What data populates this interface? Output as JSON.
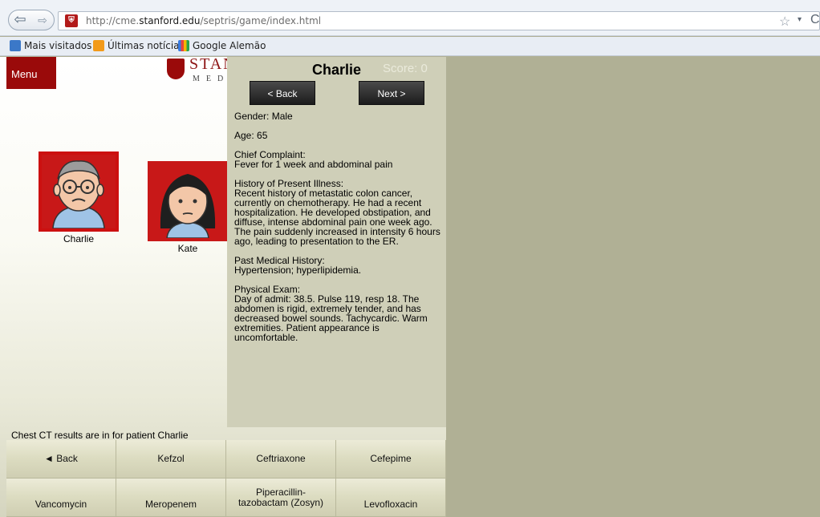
{
  "browser": {
    "url_prefix": "http://cme.",
    "url_domain": "stanford.edu",
    "url_path": "/septris/game/index.html",
    "bookmarks": [
      "Mais visitados",
      "Últimas notícias",
      "Google Alemão"
    ]
  },
  "game": {
    "menu_label": "Menu",
    "logo_text": "STANFORD",
    "logo_subtext": "MEDICINE",
    "status_message": "Chest CT results are in for patient Charlie",
    "patients": [
      {
        "name": "Charlie"
      },
      {
        "name": "Kate"
      }
    ],
    "drug_buttons": [
      "◄ Back",
      "Kefzol",
      "Ceftriaxone",
      "Cefepime",
      "Vancomycin",
      "Meropenem",
      "Piperacillin-tazobactam (Zosyn)",
      "Levofloxacin"
    ]
  },
  "panel": {
    "patient_name": "Charlie",
    "score_label": "Score: 0",
    "back_label": "< Back",
    "next_label": "Next >",
    "gender": "Gender: Male",
    "age": "Age: 65",
    "chief_complaint_label": "Chief Complaint:",
    "chief_complaint": "Fever for 1 week and abdominal pain",
    "hpi_label": "History of Present Illness:",
    "hpi": "Recent history of metastatic colon cancer, currently on chemotherapy.  He had a recent hospitalization.  He developed obstipation, and diffuse, intense abdominal pain one week ago.  The pain suddenly increased in intensity 6 hours ago, leading to presentation to the ER.",
    "pmh_label": "Past Medical History:",
    "pmh": "Hypertension; hyperlipidemia.",
    "exam_label": "Physical Exam:",
    "exam": "Day of admit: 38.5. Pulse 119, resp 18.  The abdomen is rigid, extremely tender, and has decreased bowel sounds. Tachycardic. Warm extremities. Patient appearance is uncomfortable."
  },
  "colors": {
    "menu_red": "#9a0a0a",
    "portrait_red": "#c81818",
    "panel_bg": "#cfcfb8",
    "page_bg": "#b0b095"
  }
}
